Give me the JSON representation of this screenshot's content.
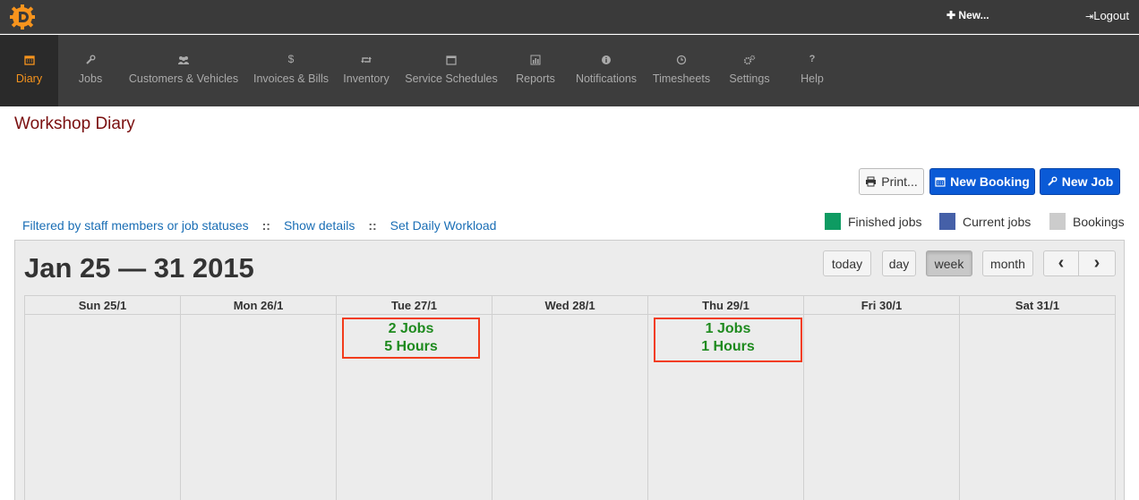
{
  "topbar": {
    "new_label": "New...",
    "logout_label": "Logout"
  },
  "nav": {
    "items": [
      {
        "label": "Diary",
        "icon": "calendar-icon"
      },
      {
        "label": "Jobs",
        "icon": "wrench-icon"
      },
      {
        "label": "Customers & Vehicles",
        "icon": "users-icon"
      },
      {
        "label": "Invoices & Bills",
        "icon": "dollar-icon"
      },
      {
        "label": "Inventory",
        "icon": "retweet-icon"
      },
      {
        "label": "Service Schedules",
        "icon": "calendar-icon"
      },
      {
        "label": "Reports",
        "icon": "bar-chart-icon"
      },
      {
        "label": "Notifications",
        "icon": "info-icon"
      },
      {
        "label": "Timesheets",
        "icon": "clock-icon"
      },
      {
        "label": "Settings",
        "icon": "gears-icon"
      },
      {
        "label": "Help",
        "icon": "question-icon"
      }
    ],
    "active": "Diary"
  },
  "page": {
    "title": "Workshop Diary"
  },
  "toolbar": {
    "print_label": "Print...",
    "new_booking_label": "New Booking",
    "new_job_label": "New Job"
  },
  "filters": {
    "staff_filter": "Filtered by staff members or job statuses",
    "separator": "::",
    "show_details": "Show details",
    "daily_workload": "Set Daily Workload"
  },
  "legend": [
    {
      "label": "Finished jobs",
      "color": "#0e9b62"
    },
    {
      "label": "Current jobs",
      "color": "#4560a8"
    },
    {
      "label": "Bookings",
      "color": "#cccccc"
    }
  ],
  "calendar": {
    "title": "Jan 25 — 31 2015",
    "buttons": {
      "today": "today",
      "day": "day",
      "week": "week",
      "month": "month",
      "prev": "‹",
      "next": "›"
    },
    "active_view": "week",
    "days": [
      {
        "label": "Sun 25/1"
      },
      {
        "label": "Mon 26/1"
      },
      {
        "label": "Tue 27/1",
        "jobs": "2 Jobs",
        "hours": "5 Hours"
      },
      {
        "label": "Wed 28/1"
      },
      {
        "label": "Thu 29/1",
        "jobs": "1 Jobs",
        "hours": "1 Hours"
      },
      {
        "label": "Fri 30/1"
      },
      {
        "label": "Sat 31/1"
      }
    ]
  },
  "colors": {
    "accent": "#f7941d",
    "primary": "#0a5ad6",
    "title": "#7a0f0f",
    "summary_text": "#1e8a1e",
    "highlight_border": "#f23c1c"
  }
}
